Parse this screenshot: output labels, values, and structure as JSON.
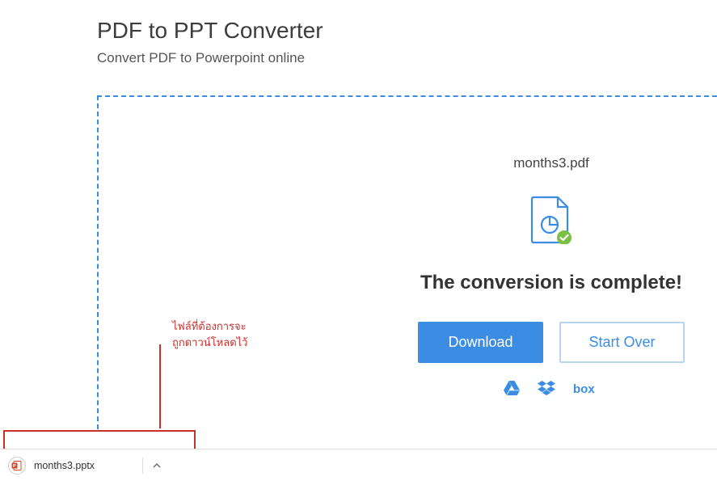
{
  "header": {
    "title": "PDF to PPT Converter",
    "subtitle": "Convert PDF to Powerpoint online"
  },
  "result": {
    "filename": "months3.pdf",
    "status_message": "The conversion is complete!",
    "download_label": "Download",
    "startover_label": "Start Over"
  },
  "storage": {
    "drive": "google-drive",
    "dropbox": "dropbox",
    "box": "box"
  },
  "annotation": {
    "line1": "ไฟล์ที่ต้องการจะ",
    "line2": "ถูกดาวน์โหลดไว้"
  },
  "download_bar": {
    "filename": "months3.pptx"
  }
}
